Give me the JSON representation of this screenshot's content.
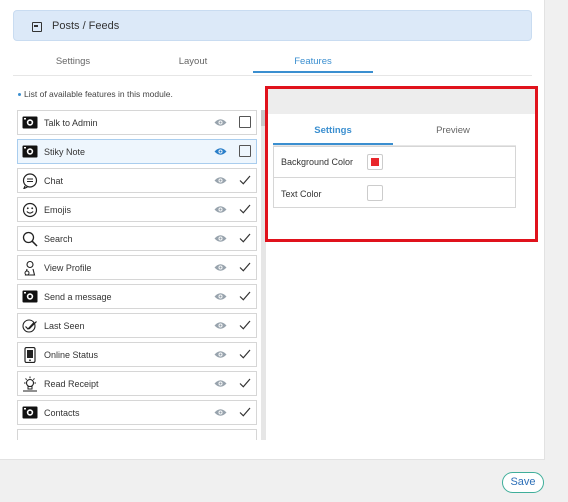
{
  "header": {
    "title": "Posts / Feeds",
    "icon": "module-icon"
  },
  "tabs": [
    {
      "label": "Settings",
      "active": false
    },
    {
      "label": "Layout",
      "active": false
    },
    {
      "label": "Features",
      "active": true
    }
  ],
  "features_hint": "List of available features in this module.",
  "features": [
    {
      "label": "Talk to Admin",
      "icon": "camera-icon",
      "check": "checkbox",
      "selected": false
    },
    {
      "label": "Stiky Note",
      "icon": "camera-icon",
      "check": "checkbox",
      "selected": true
    },
    {
      "label": "Chat",
      "icon": "chat-bubble-icon",
      "check": "checkmark",
      "selected": false
    },
    {
      "label": "Emojis",
      "icon": "smiley-icon",
      "check": "checkmark",
      "selected": false
    },
    {
      "label": "Search",
      "icon": "search-icon",
      "check": "checkmark",
      "selected": false
    },
    {
      "label": "View Profile",
      "icon": "user-profile-icon",
      "check": "checkmark",
      "selected": false
    },
    {
      "label": "Send a message",
      "icon": "camera-icon",
      "check": "checkmark",
      "selected": false
    },
    {
      "label": "Last Seen",
      "icon": "double-check-icon",
      "check": "checkmark",
      "selected": false
    },
    {
      "label": "Online Status",
      "icon": "phone-status-icon",
      "check": "checkmark",
      "selected": false
    },
    {
      "label": "Read Receipt",
      "icon": "lightbulb-icon",
      "check": "checkmark",
      "selected": false
    },
    {
      "label": "Contacts",
      "icon": "camera-icon",
      "check": "checkmark",
      "selected": false
    },
    {
      "label": "",
      "icon": "",
      "check": "",
      "selected": false
    }
  ],
  "panel": {
    "tabs": [
      {
        "label": "Settings",
        "active": true
      },
      {
        "label": "Preview",
        "active": false
      }
    ],
    "properties": [
      {
        "label": "Background Color",
        "color": "#e8262b"
      },
      {
        "label": "Text Color",
        "color": "#ffffff"
      }
    ]
  },
  "save_label": "Save",
  "colors": {
    "accent": "#3b8fd0",
    "highlight_border": "#e0121c",
    "header_bg": "#dce9f8"
  }
}
